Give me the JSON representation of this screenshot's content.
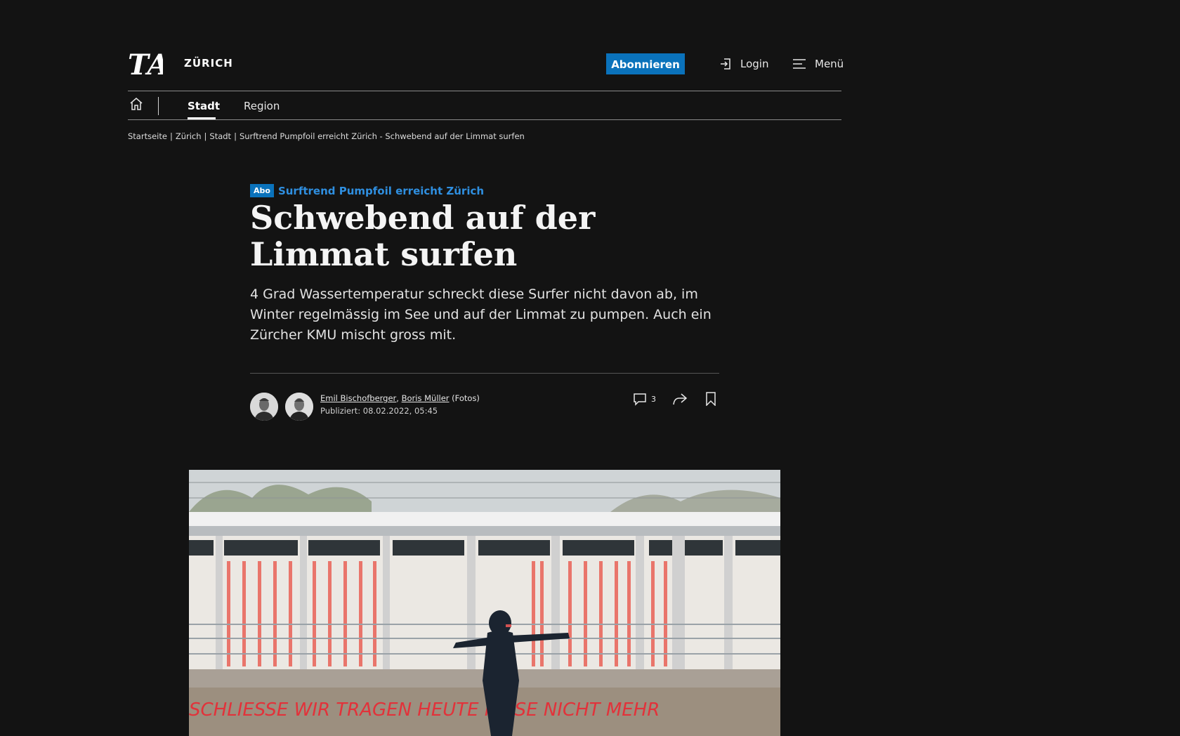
{
  "header": {
    "logo_text": "TA",
    "section": "ZÜRICH",
    "subscribe_label": "Abonnieren",
    "login_label": "Login",
    "menu_label": "Menü"
  },
  "subnav": {
    "items": [
      {
        "label": "Stadt",
        "active": true
      },
      {
        "label": "Region",
        "active": false
      }
    ]
  },
  "breadcrumb": [
    "Startseite",
    "Zürich",
    "Stadt",
    "Surftrend Pumpfoil erreicht Zürich - Schwebend auf der Limmat surfen"
  ],
  "article": {
    "badge": "Abo",
    "kicker": "Surftrend Pumpfoil erreicht Zürich",
    "headline": "Schwebend auf der Limmat surfen",
    "lead": "4 Grad Wassertemperatur schreckt diese Surfer nicht davon ab, im Winter regelmässig im See und auf der Limmat zu pumpen. Auch ein Zürcher KMU mischt gross mit.",
    "authors": [
      "Emil Bischofberger",
      "Boris Müller"
    ],
    "author_sep": ",",
    "photo_credit": "(Fotos)",
    "published": "Publiziert: 08.02.2022, 05:45",
    "comment_count": "3"
  },
  "hero_image": {
    "graffiti": "SCHLIESSE   WIR TRAGEN HEUTE   KRISE NICHT MEHR"
  },
  "colors": {
    "background": "#131313",
    "accent": "#0a72bb",
    "kicker": "#2f8fe0"
  },
  "icons": [
    "home-icon",
    "login-icon",
    "menu-icon",
    "comment-icon",
    "share-icon",
    "bookmark-icon"
  ]
}
